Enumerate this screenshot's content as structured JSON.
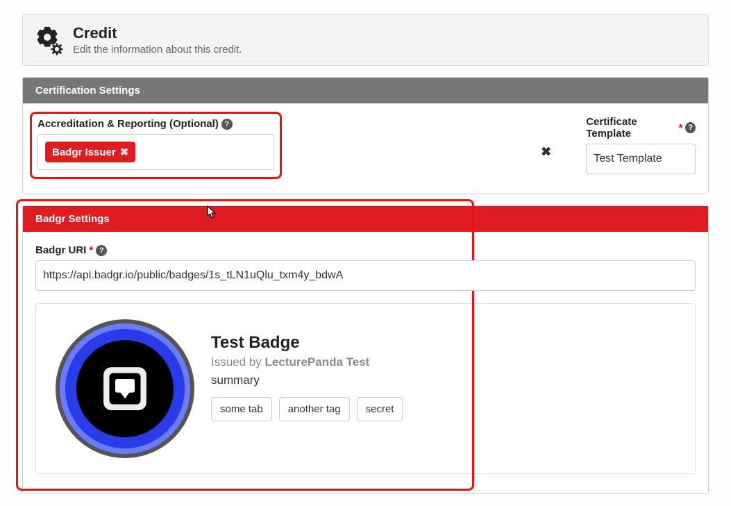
{
  "header": {
    "title": "Credit",
    "subtitle": "Edit the information about this credit."
  },
  "cert_panel": {
    "title": "Certification Settings",
    "accreditation": {
      "label": "Accreditation & Reporting (Optional)",
      "tag": "Badgr Issuer"
    },
    "template": {
      "label": "Certificate Template",
      "value": "Test Template"
    }
  },
  "badgr_panel": {
    "title": "Badgr Settings",
    "uri_label": "Badgr URI",
    "uri_value": "https://api.badgr.io/public/badges/1s_tLN1uQlu_txm4y_bdwA",
    "badge": {
      "name": "Test Badge",
      "issued_prefix": "Issued by ",
      "issued_by": "LecturePanda Test",
      "summary": "summary",
      "tags": [
        "some tab",
        "another tag",
        "secret"
      ]
    }
  }
}
